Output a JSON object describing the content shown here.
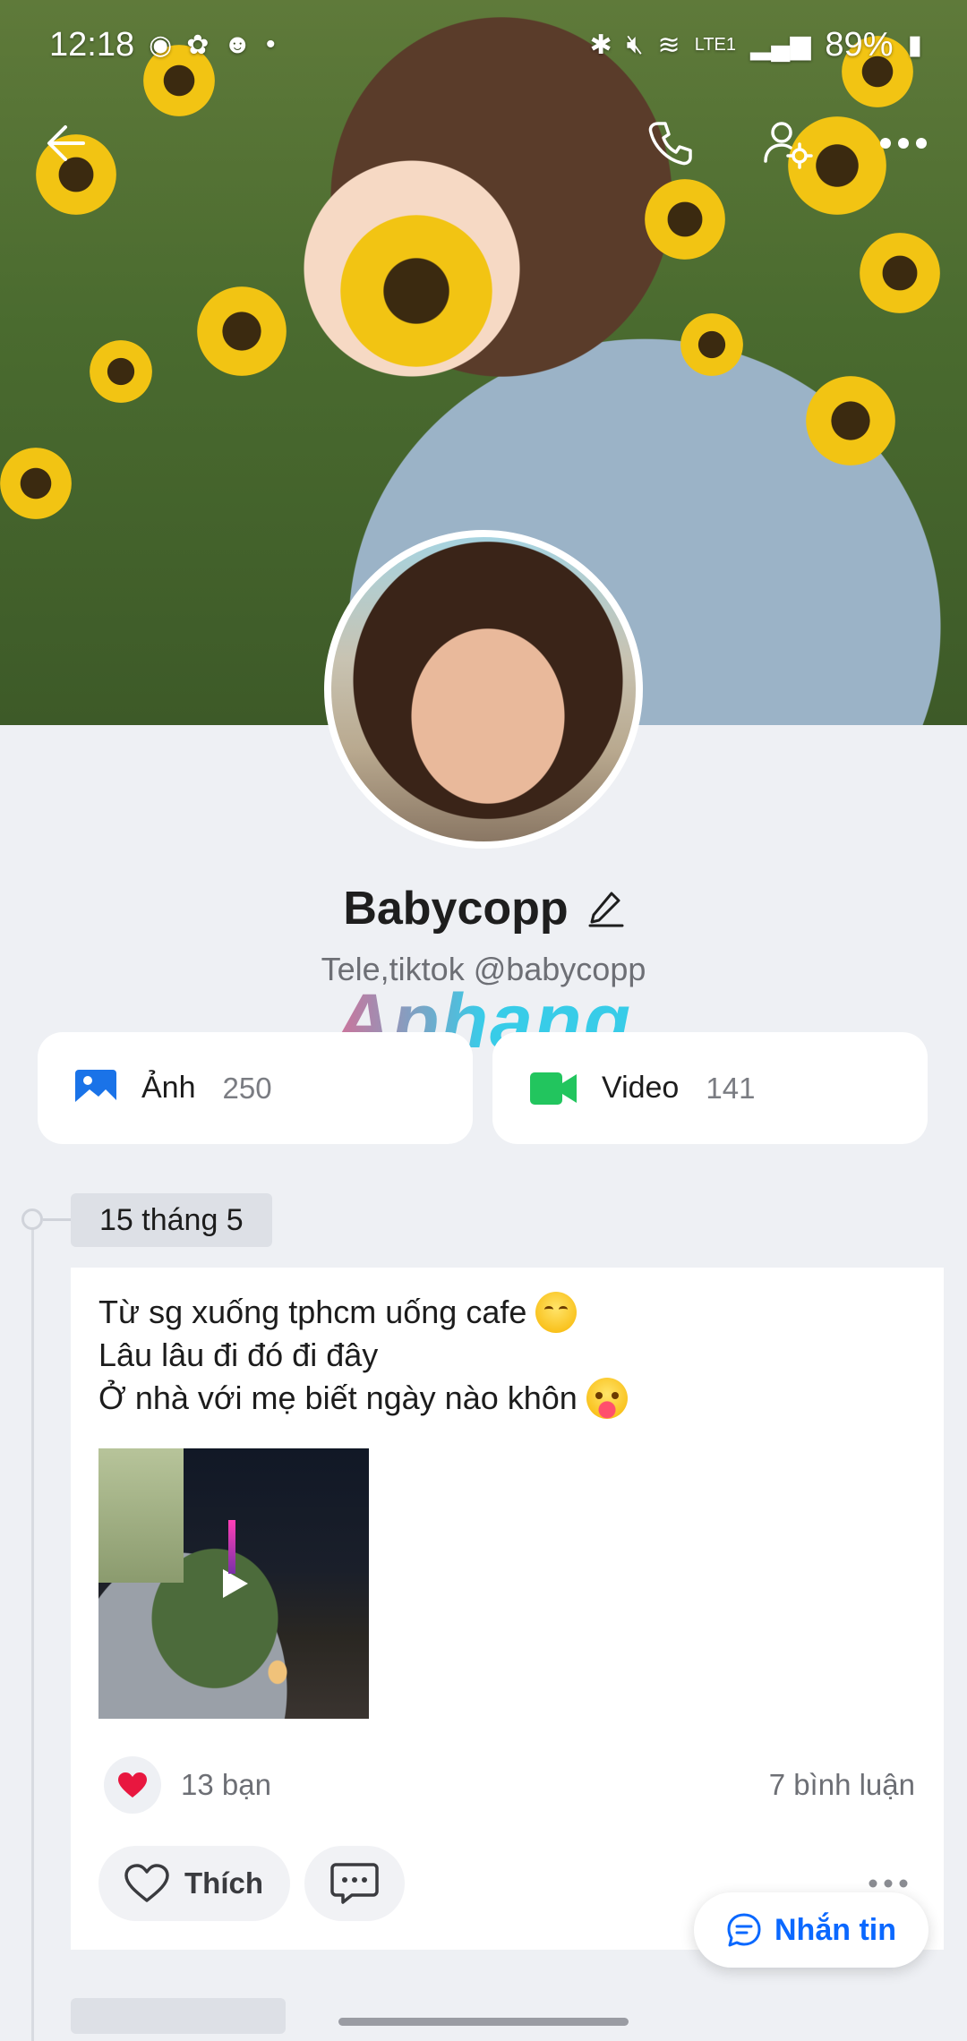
{
  "status_bar": {
    "time": "12:18",
    "battery": "89%",
    "network": "LTE1"
  },
  "profile": {
    "name": "Babycopp",
    "bio": "Tele,tiktok @babycopp",
    "watermark": "Aphang"
  },
  "media": {
    "photos": {
      "label": "Ảnh",
      "count": "250",
      "icon": "image-icon",
      "color": "#1a73e8"
    },
    "videos": {
      "label": "Video",
      "count": "141",
      "icon": "video-camera-icon",
      "color": "#22c55e"
    }
  },
  "timeline": {
    "date": "15 tháng 5"
  },
  "post": {
    "lines": [
      "Từ sg xuống tphcm uống cafe",
      "Lâu lâu đi đó đi đây",
      "Ở nhà với mẹ biết ngày nào khôn"
    ],
    "reactions": "13 bạn",
    "comments": "7 bình luận",
    "like_label": "Thích"
  },
  "floating": {
    "message_label": "Nhắn tin"
  },
  "colors": {
    "accent": "#0a68ff",
    "background": "#eef0f4",
    "heart": "#e8173f"
  }
}
